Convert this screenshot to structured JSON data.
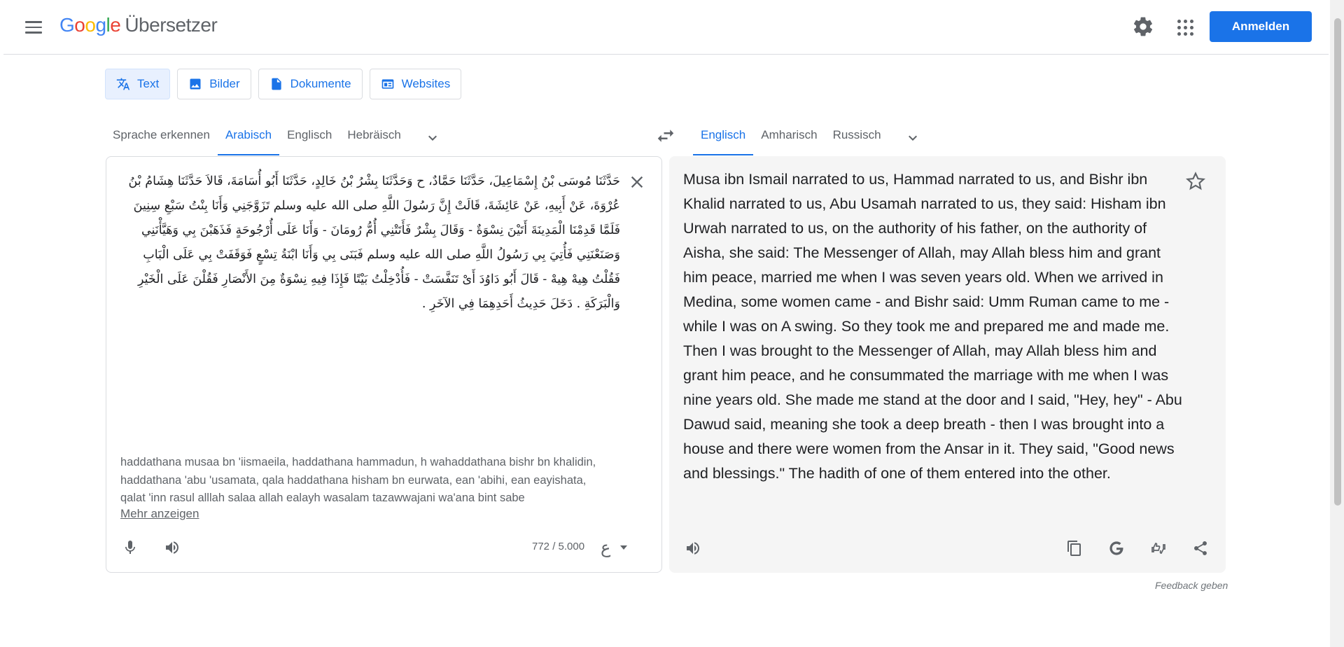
{
  "header": {
    "logo_letters": [
      "G",
      "o",
      "o",
      "g",
      "l",
      "e"
    ],
    "product": "Übersetzer",
    "signin_label": "Anmelden"
  },
  "modes": [
    {
      "label": "Text",
      "icon": "translate-icon",
      "active": true
    },
    {
      "label": "Bilder",
      "icon": "image-icon",
      "active": false
    },
    {
      "label": "Dokumente",
      "icon": "document-icon",
      "active": false
    },
    {
      "label": "Websites",
      "icon": "website-icon",
      "active": false
    }
  ],
  "source_languages": [
    "Sprache erkennen",
    "Arabisch",
    "Englisch",
    "Hebräisch"
  ],
  "source_active": "Arabisch",
  "target_languages": [
    "Englisch",
    "Amharisch",
    "Russisch"
  ],
  "target_active": "Englisch",
  "source": {
    "text": "حَدَّثَنَا مُوسَى بْنُ إِسْمَاعِيلَ، حَدَّثَنَا حَمَّادٌ، ح وَحَدَّثَنَا بِشْرُ بْنُ خَالِدٍ، حَدَّثَنَا أَبُو أُسَامَةَ، قَالاَ حَدَّثَنَا هِشَامُ بْنُ عُرْوَةَ، عَنْ أَبِيهِ، عَنْ عَائِشَةَ، قَالَتْ إِنَّ رَسُولَ اللَّهِ صلى الله عليه وسلم تَزَوَّجَنِي وَأَنَا بِنْتُ سَبْعِ سِنِينَ فَلَمَّا قَدِمْنَا الْمَدِينَةَ أَتَيْنَ نِسْوَةٌ - وَقَالَ بِشْرٌ فَأَتَتْنِي أُمُّ رُومَانَ - وَأَنَا عَلَى أُرْجُوحَةٍ فَذَهَبْنَ بِي وَهَيَّأْنَنِي وَصَنَعْنَنِي فَأُتِيَ بِي رَسُولُ اللَّهِ صلى الله عليه وسلم فَبَنَى بِي وَأَنَا ابْنَةُ تِسْعٍ فَوَقَفَتْ بِي عَلَى الْبَابِ فَقُلْتُ هِيهْ هِيهْ - قَالَ أَبُو دَاوُدَ أَىْ تَنَفَّسَتْ - فَأُدْخِلْتُ بَيْتًا فَإِذَا فِيهِ نِسْوَةٌ مِنَ الأَنْصَارِ فَقُلْنَ عَلَى الْخَيْرِ وَالْبَرَكَةِ . دَخَلَ حَدِيثُ أَحَدِهِمَا فِي الآخَرِ .",
    "transliteration": "haddathana musaa bn 'iismaeila, haddathana hammadun, h wahaddathana bishr bn khalidin, haddathana 'abu 'usamata, qala haddathana hisham bn eurwata, ean 'abihi, ean eayishata, qalat 'inn rasul alllah salaa allah ealayh wasalam tazawwajani wa'ana bint sabe",
    "more_label": "Mehr anzeigen",
    "counter": "772 / 5.000",
    "input_tool_glyph": "ع"
  },
  "target": {
    "text": "Musa ibn Ismail narrated to us, Hammad narrated to us, and Bishr ibn Khalid narrated to us, Abu Usamah narrated to us, they said: Hisham ibn Urwah narrated to us, on the authority of his father, on the authority of Aisha, she said: The Messenger of Allah, may Allah bless him and grant him peace, married me when I was seven years old. When we arrived in Medina, some women came - and Bishr said: Umm Ruman came to me - while I was on A swing. So they took me and prepared me and made me. Then I was brought to the Messenger of Allah, may Allah bless him and grant him peace, and he consummated the marriage with me when I was nine years old. She made me stand at the door and I said, \"Hey, hey\" - Abu Dawud said, meaning she took a deep breath - then I was brought into a house and there were women from the Ansar in it. They said, \"Good news and blessings.\" The hadith of one of them entered into the other."
  },
  "feedback_label": "Feedback geben",
  "colors": {
    "accent": "#1a73e8",
    "accent_bg": "#e8f0fe",
    "target_bg": "#f5f5f5",
    "icon_gray": "#5f6368"
  }
}
